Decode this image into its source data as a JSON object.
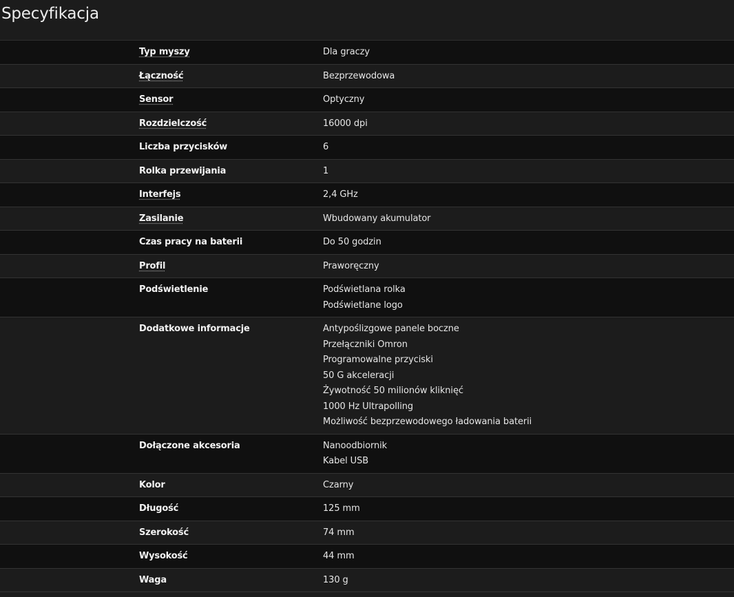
{
  "page_title": "Specyfikacja",
  "specs": [
    {
      "label": "Typ myszy",
      "underlined": true,
      "values": [
        "Dla graczy"
      ]
    },
    {
      "label": "Łączność",
      "underlined": true,
      "values": [
        "Bezprzewodowa"
      ]
    },
    {
      "label": "Sensor",
      "underlined": true,
      "values": [
        "Optyczny"
      ]
    },
    {
      "label": "Rozdzielczość",
      "underlined": true,
      "values": [
        "16000 dpi"
      ]
    },
    {
      "label": "Liczba przycisków",
      "underlined": false,
      "values": [
        "6"
      ]
    },
    {
      "label": "Rolka przewijania",
      "underlined": false,
      "values": [
        "1"
      ]
    },
    {
      "label": "Interfejs",
      "underlined": true,
      "values": [
        "2,4 GHz"
      ]
    },
    {
      "label": "Zasilanie",
      "underlined": true,
      "values": [
        "Wbudowany akumulator"
      ]
    },
    {
      "label": "Czas pracy na baterii",
      "underlined": false,
      "values": [
        "Do 50 godzin"
      ]
    },
    {
      "label": "Profil",
      "underlined": true,
      "values": [
        "Praworęczny"
      ]
    },
    {
      "label": "Podświetlenie",
      "underlined": false,
      "values": [
        "Podświetlana rolka",
        "Podświetlane logo"
      ]
    },
    {
      "label": "Dodatkowe informacje",
      "underlined": false,
      "values": [
        "Antypoślizgowe panele boczne",
        "Przełączniki Omron",
        "Programowalne przyciski",
        "50 G akceleracji",
        "Żywotność 50 milionów kliknięć",
        "1000 Hz Ultrapolling",
        "Możliwość bezprzewodowego ładowania baterii"
      ]
    },
    {
      "label": "Dołączone akcesoria",
      "underlined": false,
      "values": [
        "Nanoodbiornik",
        "Kabel USB"
      ]
    },
    {
      "label": "Kolor",
      "underlined": false,
      "values": [
        "Czarny"
      ]
    },
    {
      "label": "Długość",
      "underlined": false,
      "values": [
        "125 mm"
      ]
    },
    {
      "label": "Szerokość",
      "underlined": false,
      "values": [
        "74 mm"
      ]
    },
    {
      "label": "Wysokość",
      "underlined": false,
      "values": [
        "44 mm"
      ]
    },
    {
      "label": "Waga",
      "underlined": false,
      "values": [
        "130 g"
      ]
    }
  ]
}
